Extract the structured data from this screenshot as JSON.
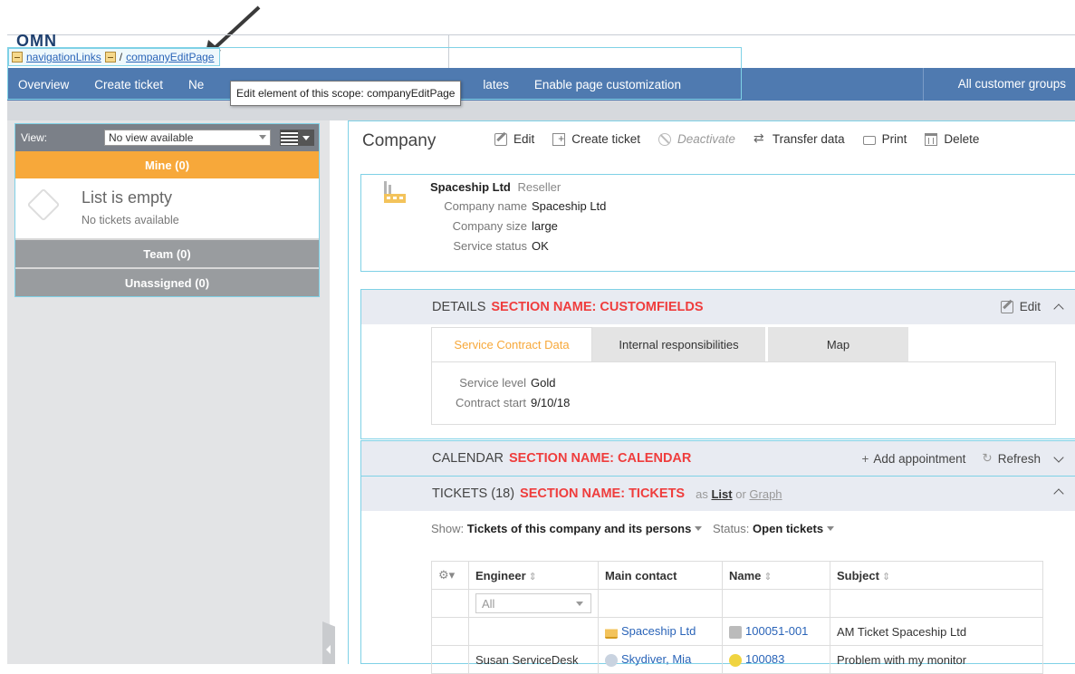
{
  "scope_bar": {
    "link1": "navigationLinks",
    "separator": "/",
    "link2": "companyEditPage"
  },
  "tooltip": "Edit element of this scope: companyEditPage",
  "nav": {
    "items": [
      "Overview",
      "Create ticket",
      "Ne",
      "lates",
      "Enable page customization"
    ],
    "right": "All customer groups"
  },
  "sidebar": {
    "view_label": "View:",
    "view_value": "No view available",
    "mine": "Mine (0)",
    "empty_title": "List is empty",
    "empty_sub": "No tickets available",
    "team": "Team (0)",
    "unassigned": "Unassigned (0)"
  },
  "page": {
    "title": "Company",
    "toolbar": {
      "edit": "Edit",
      "create_ticket": "Create ticket",
      "deactivate": "Deactivate",
      "transfer": "Transfer data",
      "print": "Print",
      "delete": "Delete"
    }
  },
  "company": {
    "name": "Spaceship Ltd",
    "type": "Reseller",
    "fields": [
      {
        "k": "Company name",
        "v": "Spaceship Ltd"
      },
      {
        "k": "Company size",
        "v": "large"
      },
      {
        "k": "Service status",
        "v": "OK"
      }
    ]
  },
  "details": {
    "title": "DETAILS",
    "name": "SECTION NAME: CUSTOMFIELDS",
    "edit": "Edit",
    "tabs": [
      "Service Contract Data",
      "Internal responsibilities",
      "Map"
    ],
    "fields": [
      {
        "k": "Service level",
        "v": "Gold"
      },
      {
        "k": "Contract start",
        "v": "9/10/18"
      }
    ]
  },
  "calendar": {
    "title": "CALENDAR",
    "name": "SECTION NAME: CALENDAR",
    "add": "Add appointment",
    "refresh": "Refresh"
  },
  "tickets": {
    "title": "TICKETS (18)",
    "name": "SECTION NAME: TICKETS",
    "as": "as",
    "list": "List",
    "or": "or",
    "graph": "Graph",
    "show_label": "Show:",
    "show_value": "Tickets of this company and its persons",
    "status_label": "Status:",
    "status_value": "Open tickets",
    "columns": [
      "Engineer",
      "Main contact",
      "Name",
      "Subject"
    ],
    "filter_value": "All",
    "rows": [
      {
        "engineer": "",
        "contact": "Spaceship Ltd",
        "name": "100051-001",
        "subject": "AM Ticket Spaceship Ltd"
      },
      {
        "engineer": "Susan ServiceDesk",
        "contact": "Skydiver, Mia",
        "name": "100083",
        "subject": "Problem with my monitor"
      }
    ]
  },
  "colors": {
    "nav": "#4f7ab0",
    "mine": "#f7a83a",
    "section_name": "#ef3d3d",
    "scope_outline": "#7fd1e6"
  }
}
